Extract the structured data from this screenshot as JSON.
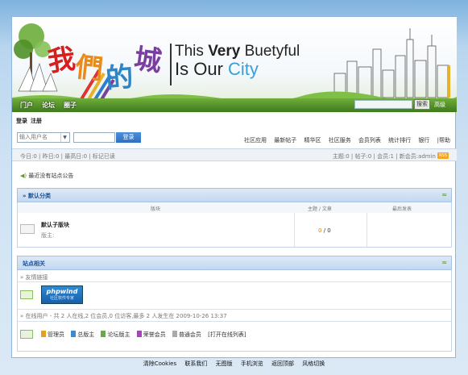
{
  "banner": {
    "title_cn": [
      "我",
      "們",
      "的",
      "城"
    ],
    "slogan_line1": [
      "This ",
      "Very ",
      "Buetyful"
    ],
    "slogan_line2": [
      "Is Our ",
      "City"
    ],
    "nav": [
      "门户",
      "论坛",
      "圈子"
    ],
    "search_button": "搜索",
    "advanced_search": "高级"
  },
  "auth": {
    "login": "登录",
    "register": "注册"
  },
  "login_form": {
    "username_placeholder": "输入用户名",
    "submit": "登录"
  },
  "topnav": [
    "社区应用",
    "最新帖子",
    "精华区",
    "社区服务",
    "会员列表",
    "统计排行",
    "银行",
    "|帮助"
  ],
  "stats_left": "今日:0 | 昨日:0 | 最高日:0 | 标记已读",
  "stats_right": "主题:0 | 帖子:0 | 会员:1 | 新会员:admin",
  "rss_label": "RSS",
  "notice": "最近没有站点公告",
  "section_default": {
    "title": "» 默认分类",
    "collapse": "≈",
    "col_forum": "版块",
    "col_topics": "主题 / 文章",
    "col_last": "最后发表",
    "forum_name": "默认子版块",
    "forum_mod": "版主:",
    "count_topics": "0",
    "count_sep": " / ",
    "count_posts": "0"
  },
  "section_site": {
    "title": "站点相关",
    "collapse": "≈",
    "links_label": "» 友情链接",
    "partner_logo_text": "phpwind",
    "partner_logo_sub": "社区软件专家",
    "online_label": "» 在线用户 - 共 2 人在线,2 位会员,0 位访客,最多 2 人发生在 2009-10-26 13:37",
    "legend": [
      {
        "label": "管理员",
        "color": "#e0a020"
      },
      {
        "label": "总版主",
        "color": "#3a8ad8"
      },
      {
        "label": "论坛版主",
        "color": "#6aa84f"
      },
      {
        "label": "荣誉会员",
        "color": "#a347b8"
      },
      {
        "label": "普通会员",
        "color": "#aaaaaa"
      }
    ],
    "open_online": "[打开在线列表]"
  },
  "footer": [
    "清除Cookies",
    "联系我们",
    "无图版",
    "手机浏览",
    "返回顶部",
    "风格切换"
  ],
  "colors": {
    "accent": "#1a4f97",
    "nav_green": "#4f8f28"
  }
}
